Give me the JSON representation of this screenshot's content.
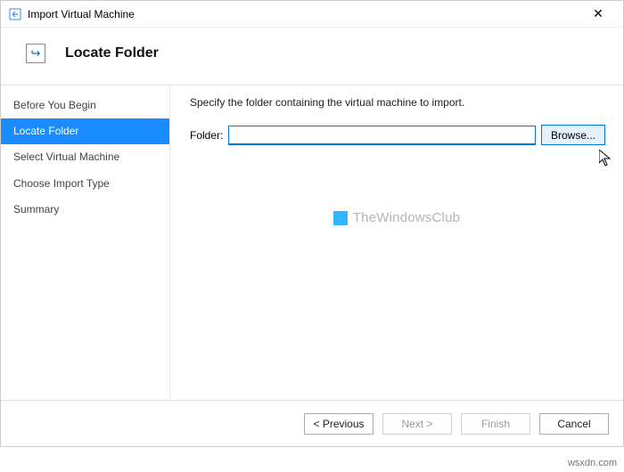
{
  "window": {
    "title": "Import Virtual Machine",
    "close_glyph": "✕"
  },
  "header": {
    "icon_glyph": "↪",
    "title": "Locate Folder"
  },
  "sidebar": {
    "items": [
      {
        "label": "Before You Begin",
        "active": false
      },
      {
        "label": "Locate Folder",
        "active": true
      },
      {
        "label": "Select Virtual Machine",
        "active": false
      },
      {
        "label": "Choose Import Type",
        "active": false
      },
      {
        "label": "Summary",
        "active": false
      }
    ]
  },
  "content": {
    "instruction": "Specify the folder containing the virtual machine to import.",
    "folder_label": "Folder:",
    "folder_value": "",
    "browse_label": "Browse..."
  },
  "watermark": {
    "text": "TheWindowsClub"
  },
  "footer": {
    "previous": "< Previous",
    "next": "Next >",
    "finish": "Finish",
    "cancel": "Cancel"
  },
  "attribution": "wsxdn.com"
}
